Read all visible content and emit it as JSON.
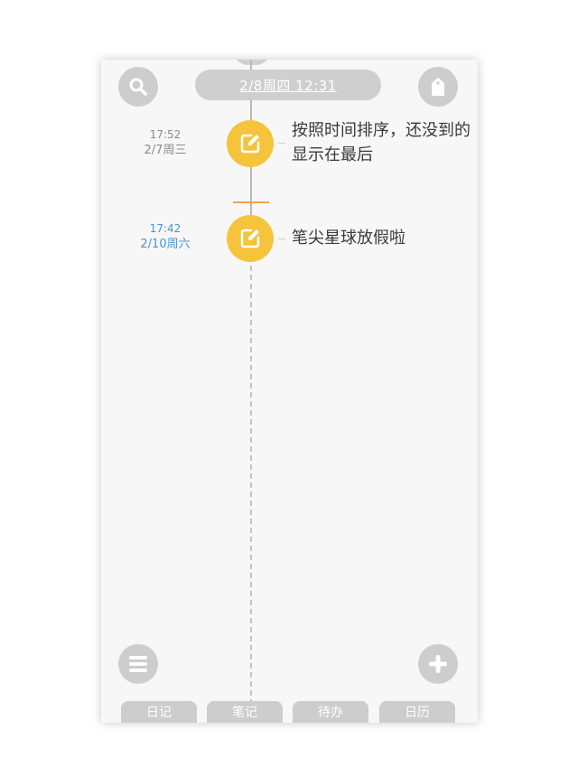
{
  "header": {
    "current_datetime": "2/8周四  12:31"
  },
  "icons": {
    "search": "search-icon",
    "tag": "tag-icon",
    "menu": "menu-icon",
    "add": "plus-icon",
    "note": "edit-note-icon"
  },
  "colors": {
    "accent_yellow": "#f6c33d",
    "future_blue": "#4a95cf",
    "now_marker": "#f2a154",
    "gray_ui": "#cdcdcd"
  },
  "entries": [
    {
      "time": "17:52",
      "date": "2/7周三",
      "text": "按照时间排序，还没到的显示在最后",
      "state": "past"
    },
    {
      "time": "17:42",
      "date": "2/10周六",
      "text": "笔尖星球放假啦",
      "state": "future"
    }
  ],
  "tabs": [
    {
      "label": "日记"
    },
    {
      "label": "笔记"
    },
    {
      "label": "待办"
    },
    {
      "label": "日历"
    }
  ]
}
